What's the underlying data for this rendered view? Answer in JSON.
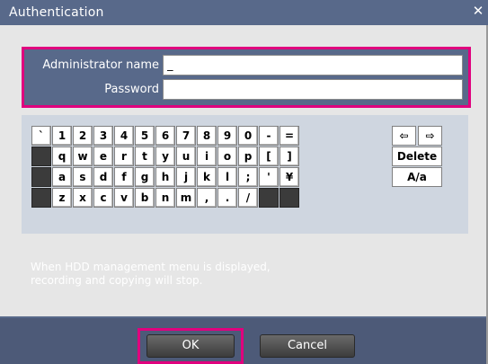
{
  "window": {
    "title": "Authentication",
    "close_glyph": "✕"
  },
  "fields": {
    "admin_label": "Administrator name",
    "admin_value": "_",
    "password_label": "Password",
    "password_value": ""
  },
  "keyboard": {
    "rows": [
      [
        "`",
        "1",
        "2",
        "3",
        "4",
        "5",
        "6",
        "7",
        "8",
        "9",
        "0",
        "-",
        "="
      ],
      [
        "",
        "q",
        "w",
        "e",
        "r",
        "t",
        "y",
        "u",
        "i",
        "o",
        "p",
        "[",
        "]"
      ],
      [
        "",
        "a",
        "s",
        "d",
        "f",
        "g",
        "h",
        "j",
        "k",
        "l",
        ";",
        "'",
        "¥"
      ],
      [
        "",
        "z",
        "x",
        "c",
        "v",
        "b",
        "n",
        "m",
        ",",
        ".",
        "/",
        "",
        ""
      ]
    ],
    "left_arrow": "⇦",
    "right_arrow": "⇨",
    "delete_label": "Delete",
    "case_label": "A/a"
  },
  "message": "When HDD management menu is displayed,\nrecording and copying will stop.",
  "buttons": {
    "ok_label": "OK",
    "cancel_label": "Cancel"
  },
  "colors": {
    "title_bar": "#58698a",
    "highlight": "#e0007e",
    "panel": "#e6e6e6",
    "keyboard_bg": "#cfd6e0",
    "bottom_bar": "#4d5a78"
  },
  "icons": {
    "close": "close-icon",
    "arrow_left": "arrow-left-icon",
    "arrow_right": "arrow-right-icon"
  }
}
